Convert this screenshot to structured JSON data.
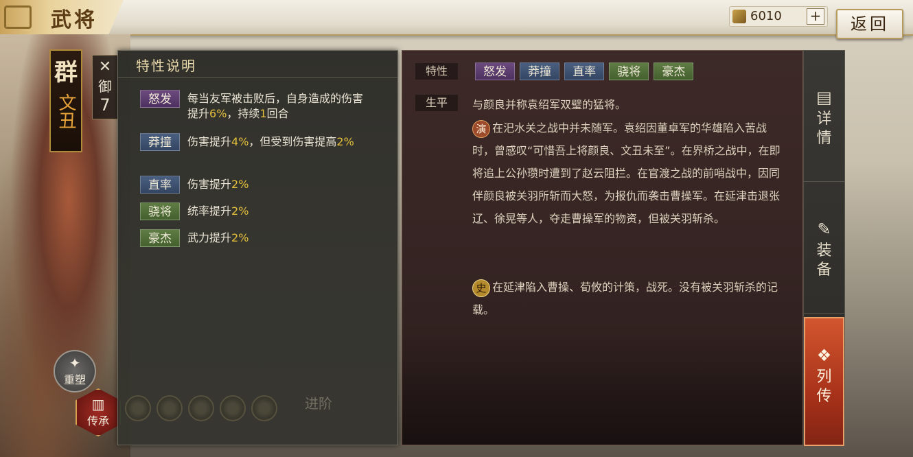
{
  "header": {
    "title": "武将",
    "currency_amount": "6010",
    "add_label": "+",
    "back_label": "返回"
  },
  "hero": {
    "faction": "群",
    "name": "文丑",
    "troop_type_label": "御",
    "troop_type_value": "7",
    "rebuild_label": "重塑",
    "inherit_label": "传承"
  },
  "trait_panel": {
    "title": "特性说明",
    "traits": [
      {
        "tag": "怒发",
        "color": "purple",
        "desc_parts": [
          "每当友军被击败后，自身造成的伤害提升",
          "6%",
          "，持续",
          "1",
          "回合"
        ]
      },
      {
        "tag": "莽撞",
        "color": "blue",
        "desc_parts": [
          "伤害提升",
          "4%",
          "，但受到伤害提高",
          "2%",
          ""
        ]
      },
      {
        "tag": "直率",
        "color": "blue",
        "desc_parts": [
          "伤害提升",
          "2%",
          "",
          "",
          ""
        ]
      },
      {
        "tag": "骁将",
        "color": "green",
        "desc_parts": [
          "统率提升",
          "2%",
          "",
          "",
          ""
        ]
      },
      {
        "tag": "豪杰",
        "color": "green",
        "desc_parts": [
          "武力提升",
          "2%",
          "",
          "",
          ""
        ]
      }
    ],
    "advance_label": "进阶"
  },
  "bio_panel": {
    "traits_label": "特性",
    "tags": [
      {
        "text": "怒发",
        "color": "purple"
      },
      {
        "text": "莽撞",
        "color": "blue"
      },
      {
        "text": "直率",
        "color": "blue"
      },
      {
        "text": "骁将",
        "color": "green"
      },
      {
        "text": "豪杰",
        "color": "green"
      }
    ],
    "biography_label": "生平",
    "summary": "与颜良并称袁绍军双璧的猛将。",
    "novel_mark": "演",
    "novel_text": "在汜水关之战中并未随军。袁绍因董卓军的华雄陷入苦战时，曾感叹“可惜吾上将颜良、文丑未至”。在界桥之战中，在即将追上公孙瓒时遭到了赵云阻拦。在官渡之战的前哨战中，因同伴颜良被关羽所斩而大怒，为报仇而袭击曹操军。在延津击退张辽、徐晃等人，夺走曹操军的物资，但被关羽斩杀。",
    "history_mark": "史",
    "history_text": "在延津陷入曹操、荀攸的计策，战死。没有被关羽斩杀的记载。"
  },
  "tabs": [
    {
      "label_1": "详",
      "label_2": "情",
      "icon": "scroll-icon"
    },
    {
      "label_1": "装",
      "label_2": "备",
      "icon": "equipment-icon"
    },
    {
      "label_1": "列",
      "label_2": "传",
      "icon": "biography-icon"
    }
  ]
}
